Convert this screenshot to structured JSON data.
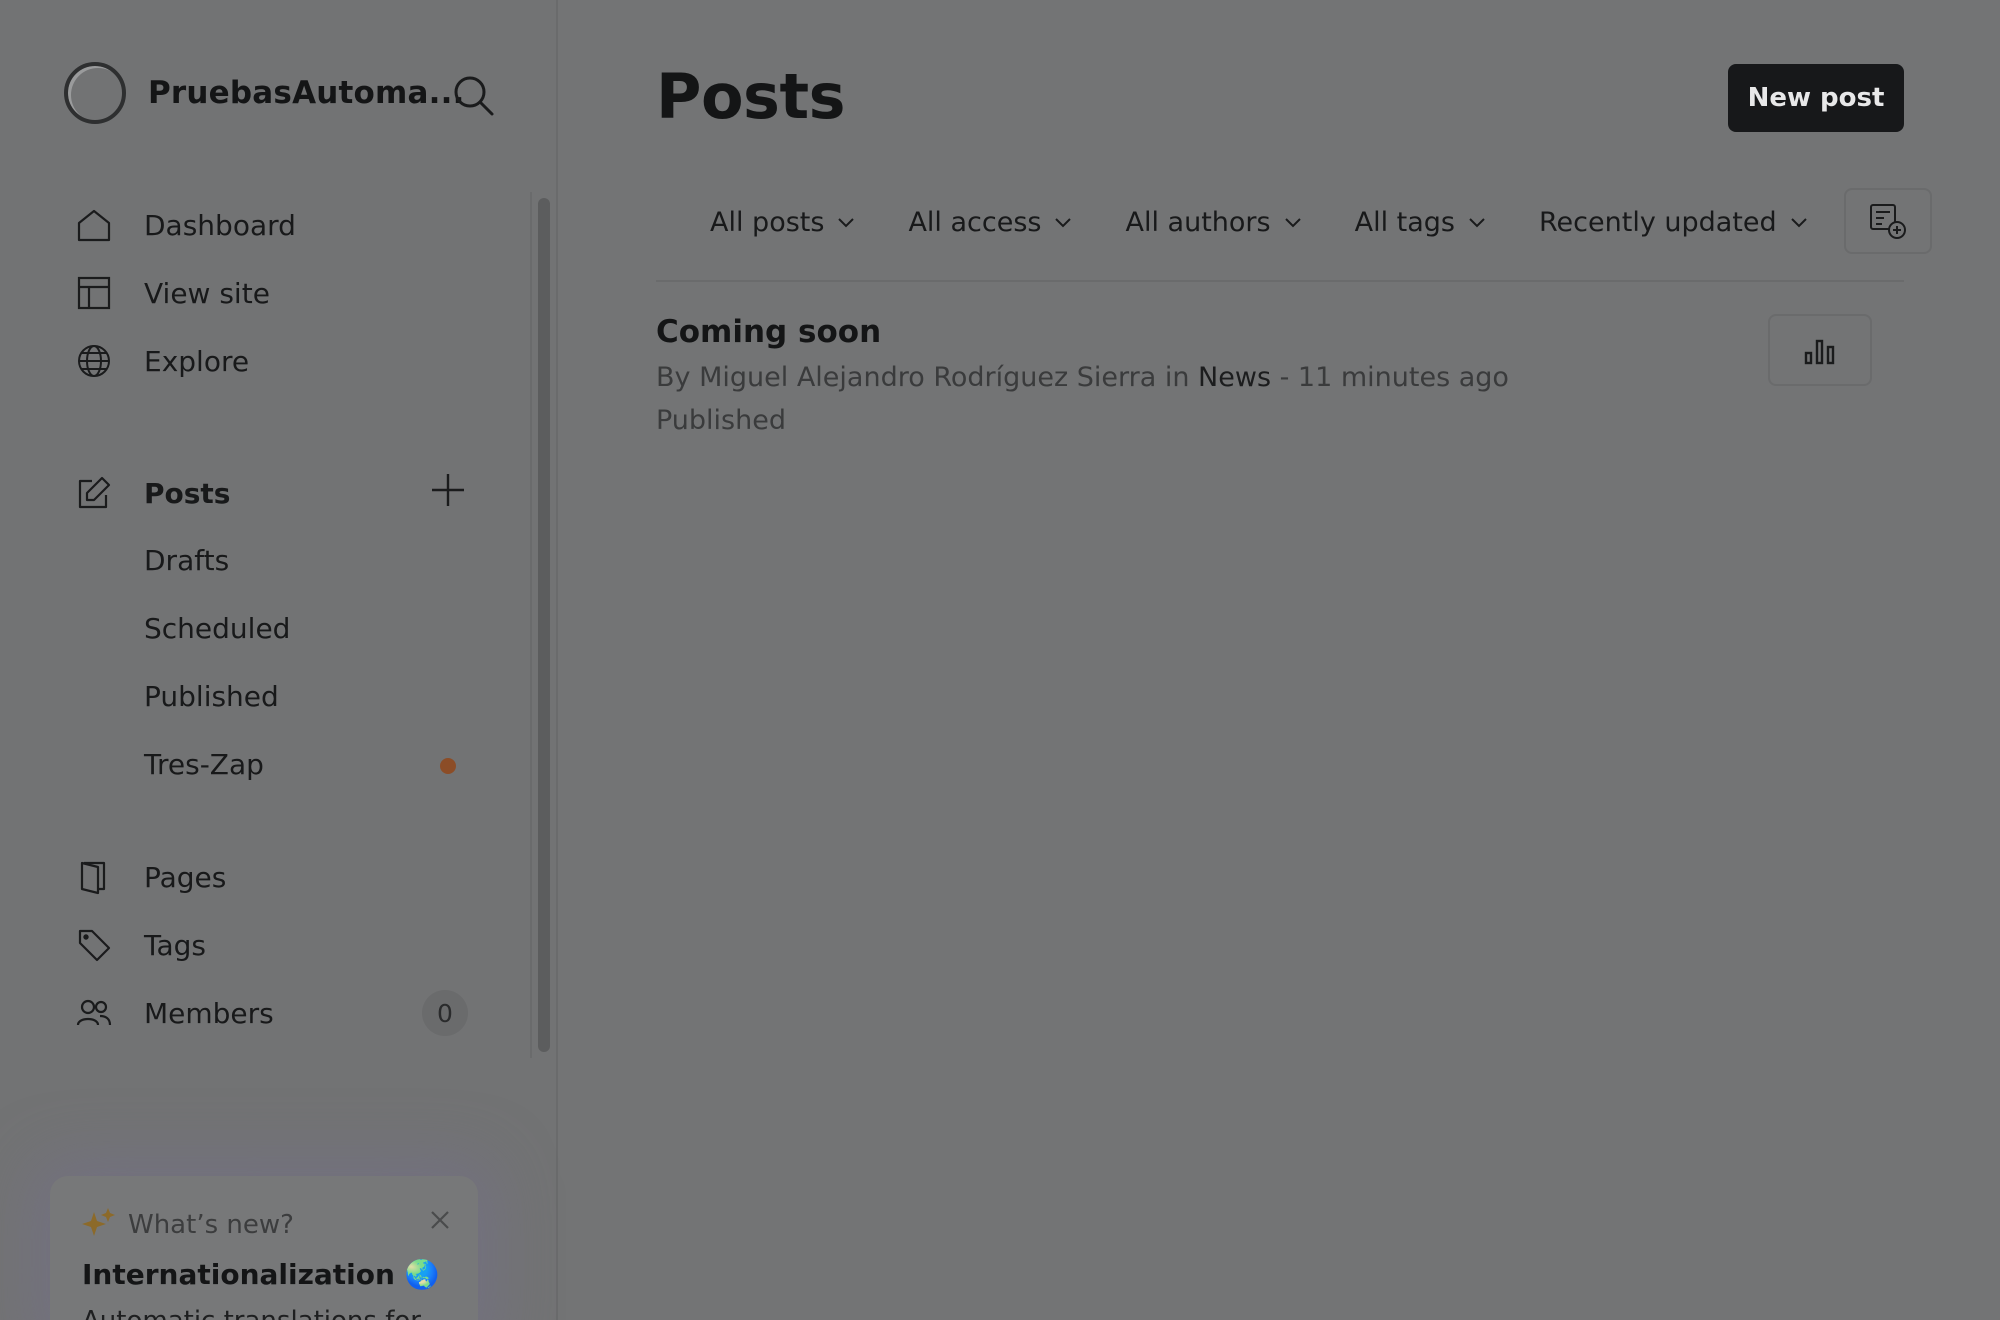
{
  "sidebar": {
    "brand_name": "PruebasAutoma...",
    "nav": [
      {
        "label": "Dashboard",
        "icon": "home-icon"
      },
      {
        "label": "View site",
        "icon": "layout-icon"
      },
      {
        "label": "Explore",
        "icon": "globe-icon"
      }
    ],
    "posts": {
      "label": "Posts",
      "icon": "edit-icon",
      "sub_items": [
        "Drafts",
        "Scheduled",
        "Published",
        "Tres-Zap"
      ]
    },
    "more": [
      {
        "label": "Pages",
        "icon": "page-icon"
      },
      {
        "label": "Tags",
        "icon": "tag-icon"
      },
      {
        "label": "Members",
        "icon": "members-icon"
      }
    ],
    "members_count": "0",
    "whats_new": {
      "heading": "What’s new?",
      "title": "Internationalization 🌏",
      "description": "Automatic translations for"
    }
  },
  "main": {
    "title": "Posts",
    "new_post_label": "New post",
    "filters": [
      "All posts",
      "All access",
      "All authors",
      "All tags",
      "Recently updated"
    ],
    "post": {
      "title": "Coming soon",
      "meta_prefix": "By Miguel Alejandro Rodríguez Sierra in ",
      "meta_tag": "News",
      "meta_suffix": " - 11 minutes ago",
      "status": "Published"
    }
  },
  "colors": {
    "overlay_bg": "#737475",
    "button_dark": "#17181a",
    "notification_dot": "#8c4d27"
  }
}
